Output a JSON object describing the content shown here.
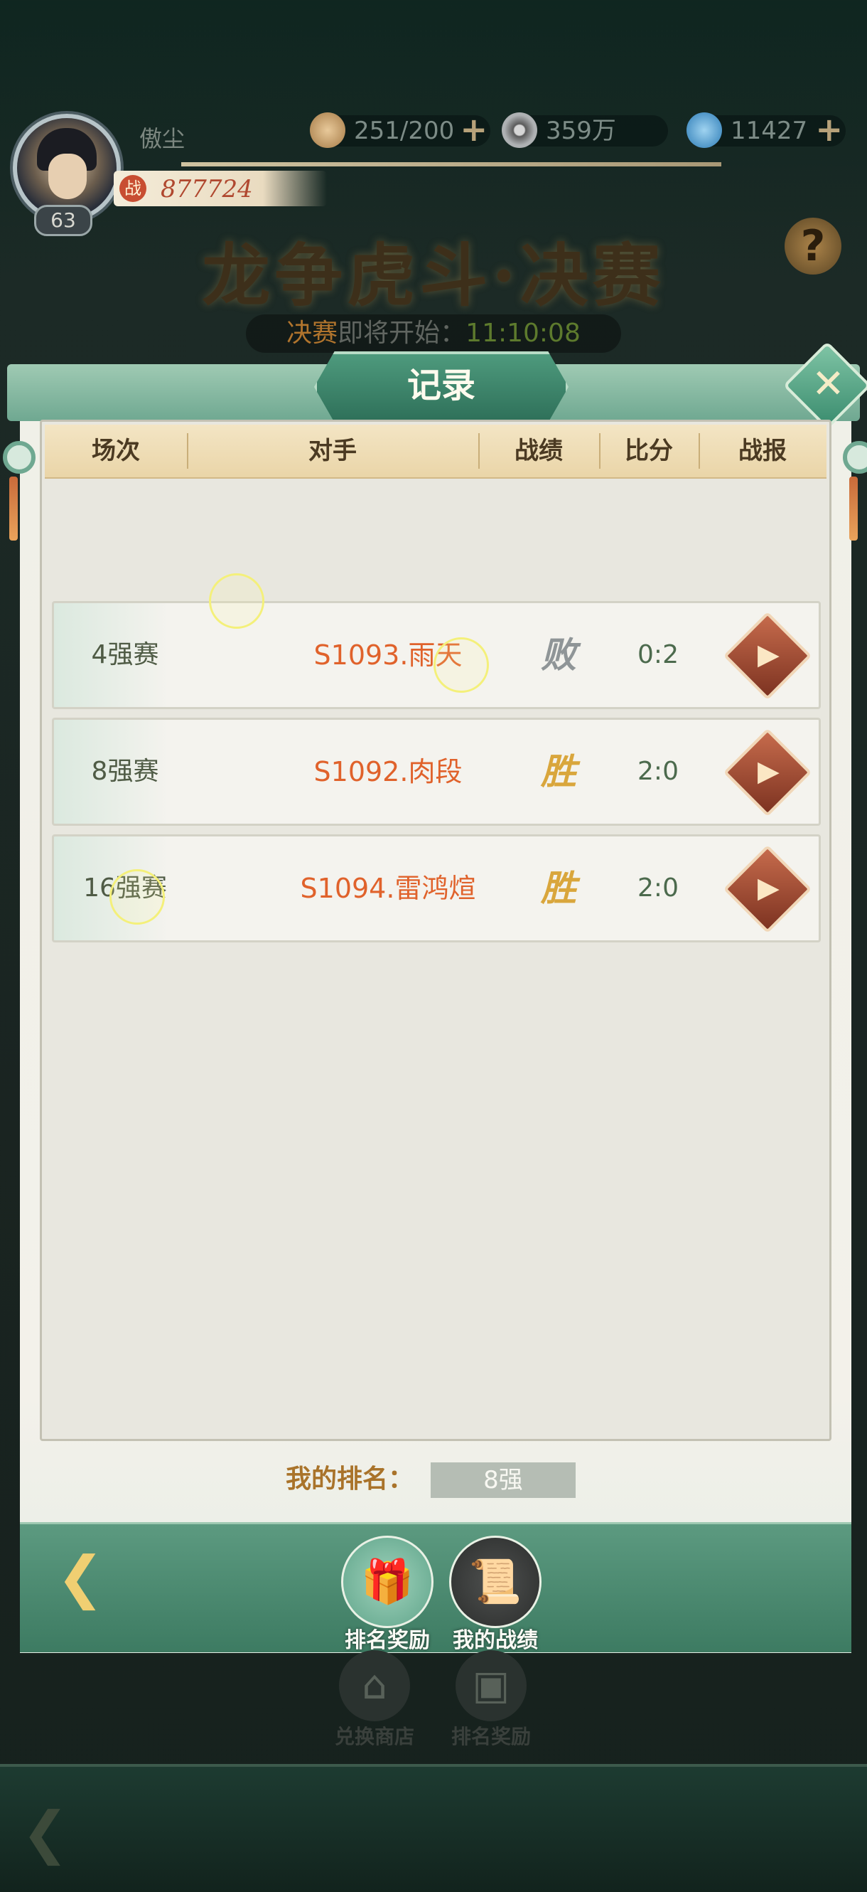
{
  "hud": {
    "player_name": "傲尘",
    "level": "63",
    "power_icon": "战",
    "power": "877724",
    "resource1": "251/200",
    "resource2": "359万",
    "resource3": "11427"
  },
  "event": {
    "title": "龙争虎斗·决赛",
    "countdown_label_highlight": "决赛",
    "countdown_label_rest": "即将开始：",
    "countdown_time": "11:10:08"
  },
  "dialog": {
    "title": "记录",
    "close_glyph": "✕",
    "columns": [
      "场次",
      "对手",
      "战绩",
      "比分",
      "战报"
    ],
    "rows": [
      {
        "round": "4强赛",
        "opponent": "S1093.雨天",
        "result": "败",
        "result_type": "lose",
        "score": "0:2"
      },
      {
        "round": "8强赛",
        "opponent": "S1092.肉段",
        "result": "胜",
        "result_type": "win",
        "score": "2:0"
      },
      {
        "round": "16强赛",
        "opponent": "S1094.雷鸿煊",
        "result": "胜",
        "result_type": "win",
        "score": "2:0"
      }
    ],
    "my_rank_label": "我的排名：",
    "my_rank_value": "8强"
  },
  "tabs": {
    "back_glyph": "❮",
    "reward_label": "排名奖励",
    "record_label": "我的战绩"
  },
  "background_icons": {
    "shop_label": "兑换商店",
    "reward_label": "排名奖励"
  },
  "colors": {
    "accent_green": "#3d7b62",
    "opponent_orange": "#e0622b",
    "win_gold": "#d9a63c",
    "lose_gray": "#8f9597"
  }
}
